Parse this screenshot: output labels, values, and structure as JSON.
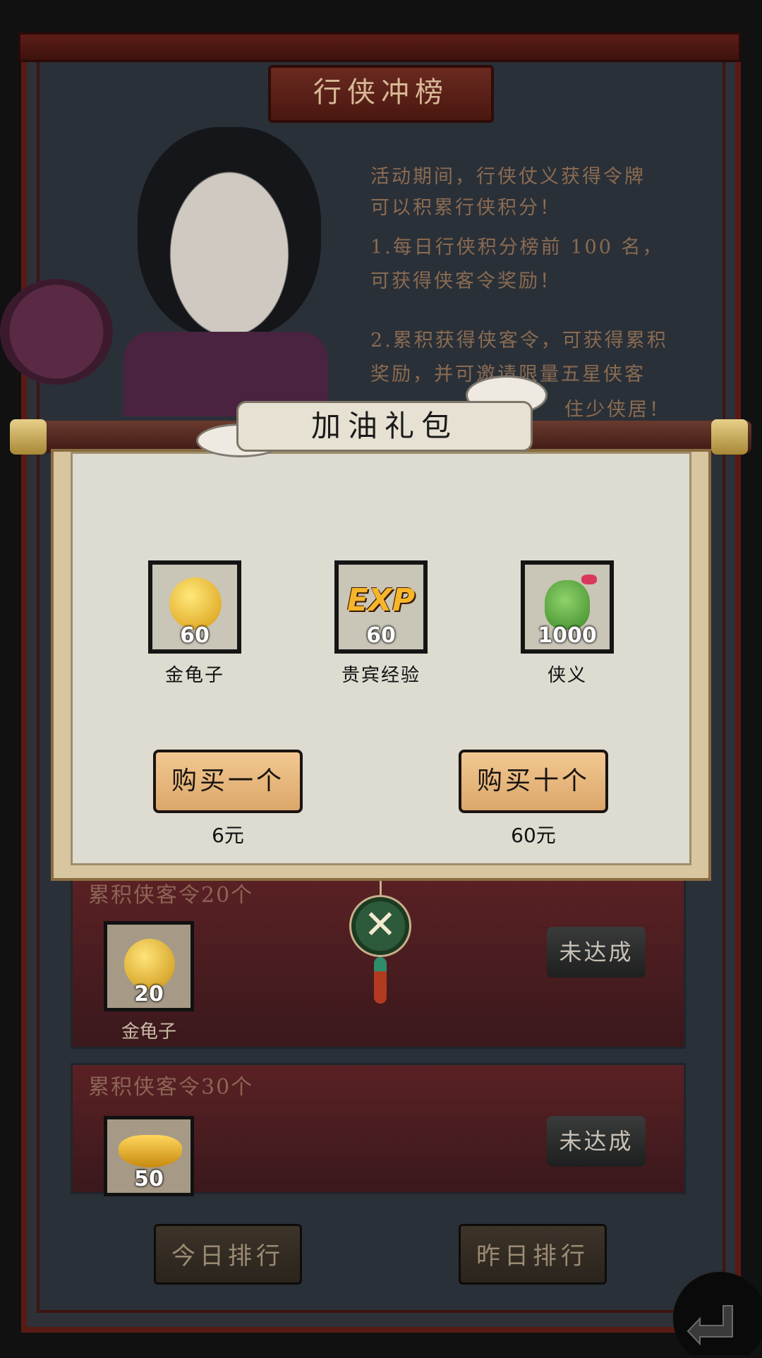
{
  "header": {
    "title": "行侠冲榜"
  },
  "description": {
    "lines": [
      "活动期间，行侠仗义获得令牌",
      "可以积累行侠积分！",
      "1.每日行侠积分榜前 100 名，",
      "可获得侠客令奖励！",
      "2.累积获得侠客令，可获得累积",
      "奖励，并可邀请限量五星侠客",
      "住少侠居！"
    ]
  },
  "popup": {
    "title": "加油礼包",
    "rewards": [
      {
        "name": "金龟子",
        "qty": "60",
        "icon": "gold-beetle-icon",
        "color": "#f0b81c"
      },
      {
        "name": "贵宾经验",
        "qty": "60",
        "icon": "exp-icon",
        "color": "#f2a21a"
      },
      {
        "name": "侠义",
        "qty": "1000",
        "icon": "green-pouch-icon",
        "color": "#4e9a3a"
      }
    ],
    "buy_one": {
      "label": "购买一个",
      "price": "6元"
    },
    "buy_ten": {
      "label": "购买十个",
      "price": "60元"
    },
    "close_icon": "close-icon"
  },
  "milestones": [
    {
      "label": "累积侠客令20个",
      "reward_name": "金龟子",
      "reward_qty": "20",
      "status": "未达成"
    },
    {
      "label": "累积侠客令30个",
      "reward_qty": "50",
      "status": "未达成"
    }
  ],
  "footer": {
    "today_rank": "今日排行",
    "yesterday_rank": "昨日排行"
  }
}
